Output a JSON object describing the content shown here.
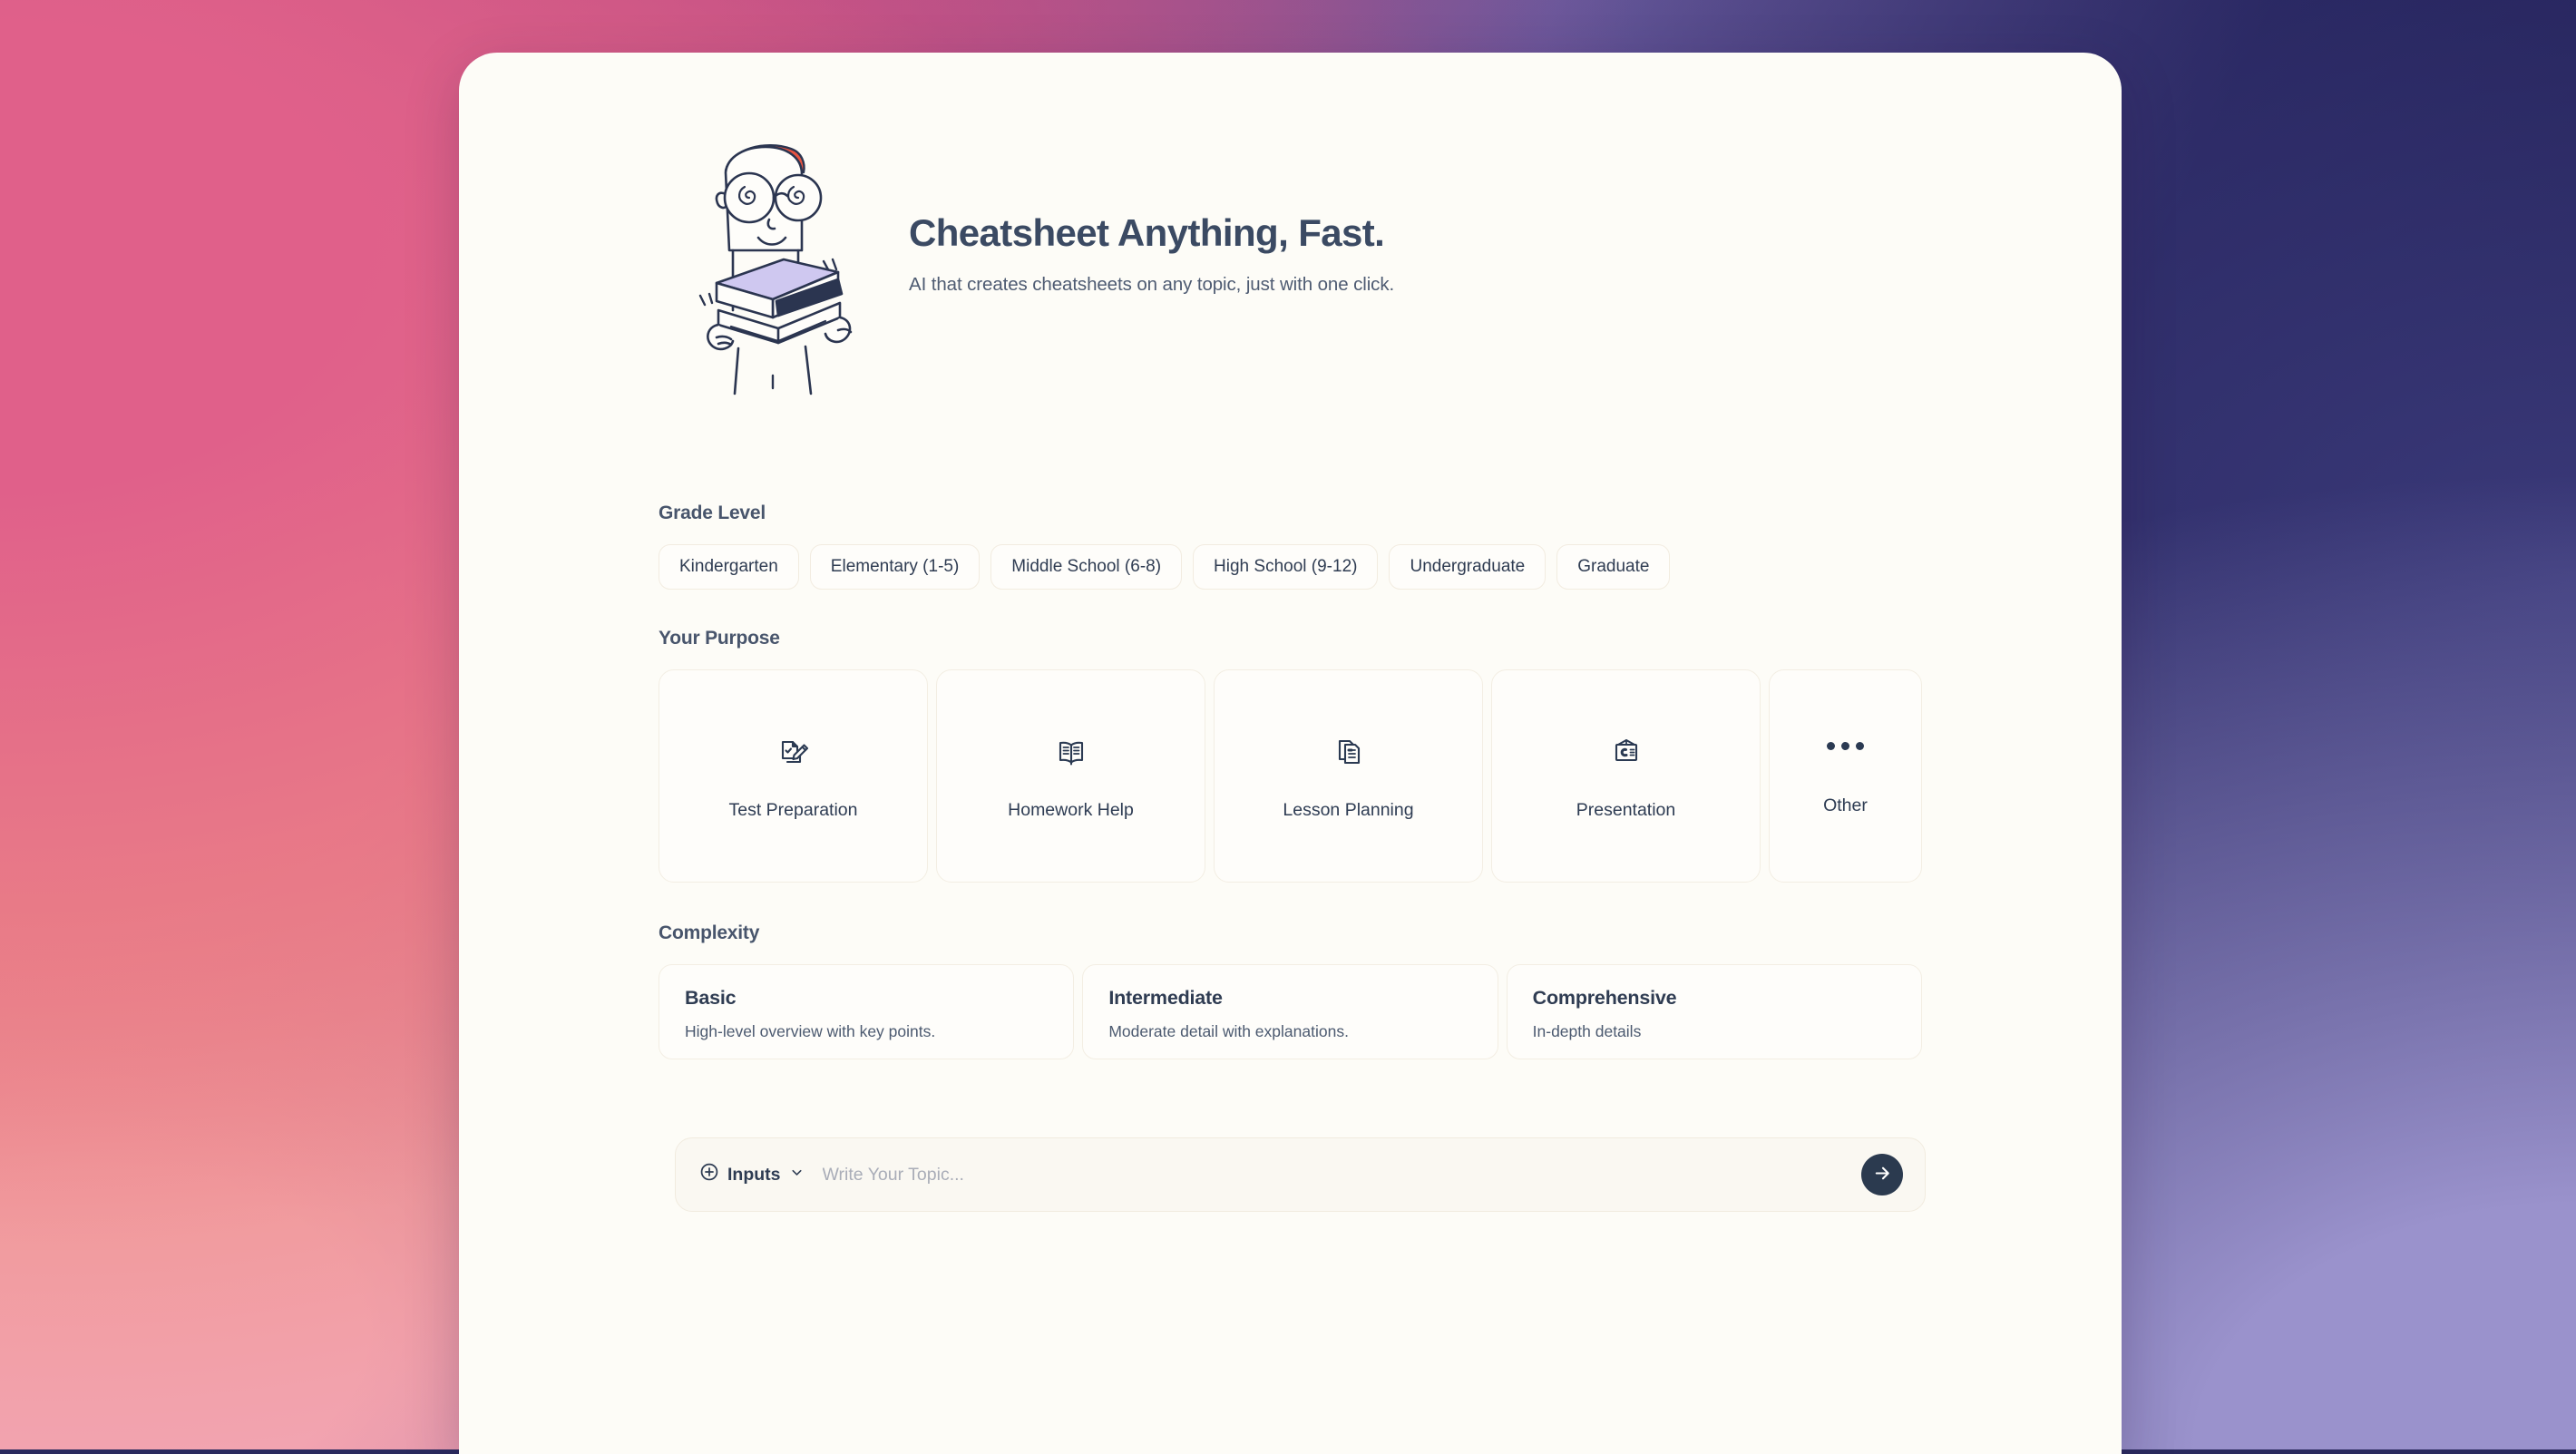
{
  "theme": {
    "card_bg": "#fdfcf7",
    "text_dark": "#2f3c52",
    "heading": "#48556c",
    "accent_dark": "#2b3a4f",
    "chip_border": "#f2ece0",
    "gradient_pink": "#d95f85",
    "gradient_navy": "#1b1a4d",
    "gradient_lavender": "#9a92cc",
    "hair_red": "#e85440",
    "book_lavender": "#cfc8f0"
  },
  "hero": {
    "title": "Cheatsheet Anything, Fast.",
    "subtitle": "AI that creates cheatsheets on any topic, just with one click.",
    "illustration": "student-holding-books-illustration"
  },
  "grade_level": {
    "title": "Grade Level",
    "options": [
      {
        "label": "Kindergarten"
      },
      {
        "label": "Elementary (1-5)"
      },
      {
        "label": "Middle School (6-8)"
      },
      {
        "label": "High School (9-12)"
      },
      {
        "label": "Undergraduate"
      },
      {
        "label": "Graduate"
      }
    ]
  },
  "purpose": {
    "title": "Your Purpose",
    "options": [
      {
        "label": "Test Preparation",
        "icon": "document-pencil-icon"
      },
      {
        "label": "Homework Help",
        "icon": "open-book-icon"
      },
      {
        "label": "Lesson Planning",
        "icon": "copy-documents-icon"
      },
      {
        "label": "Presentation",
        "icon": "presentation-board-icon"
      },
      {
        "label": "Other",
        "icon": "ellipsis-icon"
      }
    ]
  },
  "complexity": {
    "title": "Complexity",
    "options": [
      {
        "label": "Basic",
        "description": "High-level overview with key points."
      },
      {
        "label": "Intermediate",
        "description": "Moderate detail with explanations."
      },
      {
        "label": "Comprehensive",
        "description": "In-depth details"
      }
    ]
  },
  "composer": {
    "inputs_label": "Inputs",
    "inputs_icon": "plus-circle-icon",
    "chevron_icon": "chevron-down-icon",
    "topic_value": "",
    "topic_placeholder": "Write Your Topic...",
    "submit_icon": "arrow-right-icon"
  }
}
